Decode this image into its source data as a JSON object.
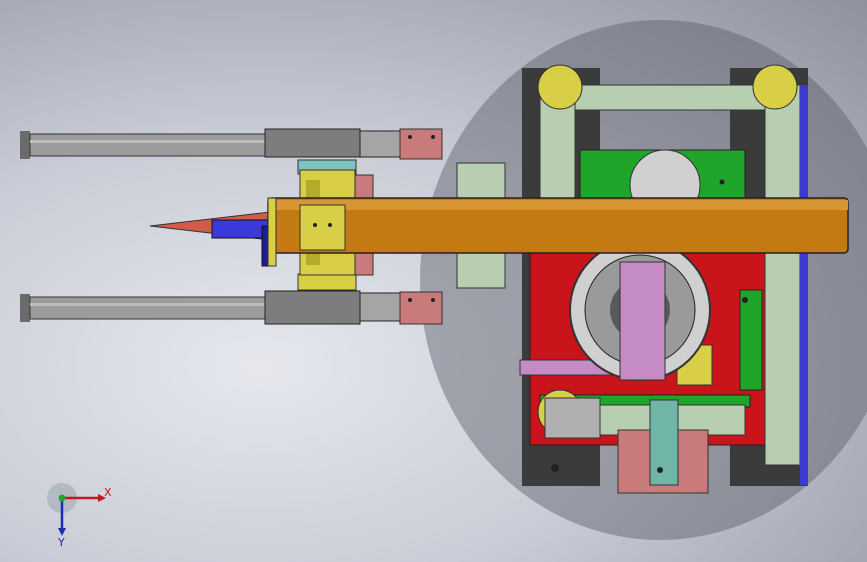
{
  "viewport": {
    "background_color": "#c9ccd6",
    "part_colors": {
      "arm": "#c47a12",
      "frame_red": "#c8141a",
      "plate_green": "#1fa52a",
      "rail_green": "#b7ceb0",
      "cylinder": "#8a8a8a",
      "pink_block": "#c97a7a",
      "yellow_block": "#d9cf47",
      "dark_motor": "#3a3a3a"
    }
  },
  "triad": {
    "x_label": "X",
    "y_label": "Y",
    "x_color": "#c0191f",
    "y_color": "#1b2bb3"
  }
}
